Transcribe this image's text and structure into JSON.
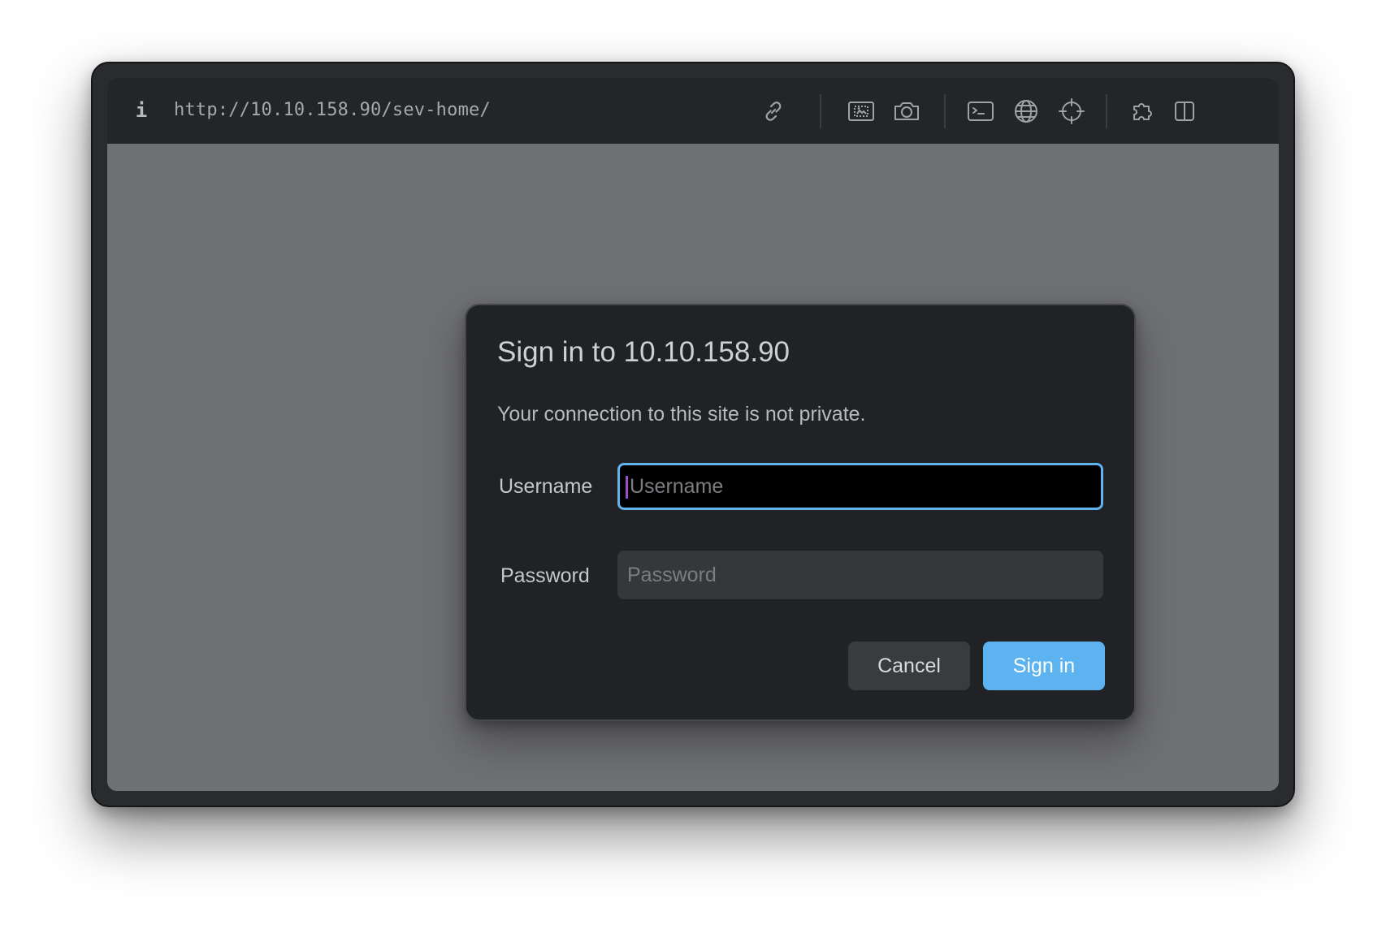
{
  "toolbar": {
    "info_icon": "i",
    "url": "http://10.10.158.90/sev-home/",
    "icons": [
      "link-icon",
      "screenshot-area-icon",
      "camera-icon",
      "terminal-icon",
      "globe-icon",
      "crosshair-icon",
      "extensions-icon",
      "split-view-icon"
    ]
  },
  "dialog": {
    "title": "Sign in to 10.10.158.90",
    "message": "Your connection to this site is not private.",
    "username_label": "Username",
    "username_placeholder": "Username",
    "username_value": "",
    "password_label": "Password",
    "password_placeholder": "Password",
    "password_value": "",
    "cancel_label": "Cancel",
    "signin_label": "Sign in"
  },
  "colors": {
    "window_frame": "#2a2b2e",
    "toolbar_bg": "#242528",
    "page_overlay": "#6f7073",
    "dialog_bg": "#202226",
    "accent": "#5db3ef",
    "focus_ring": "#62b2ee"
  }
}
